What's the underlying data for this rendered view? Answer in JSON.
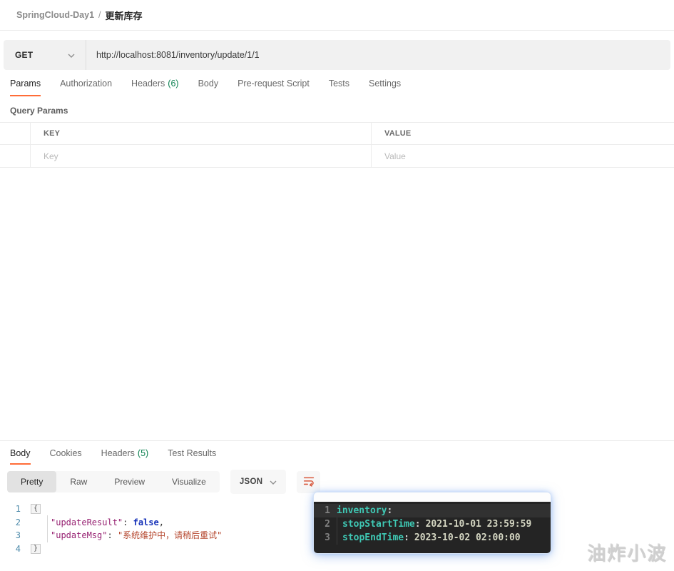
{
  "colors": {
    "accent": "#ff6c37",
    "count_green": "#0b8050",
    "method_bar_bg": "#f1f1f1"
  },
  "breadcrumb": {
    "collection": "SpringCloud-Day1",
    "separator": "/",
    "request_name": "更新库存"
  },
  "request_bar": {
    "method": "GET",
    "url": "http://localhost:8081/inventory/update/1/1"
  },
  "request_tabs": [
    {
      "label": "Params"
    },
    {
      "label": "Authorization"
    },
    {
      "label": "Headers",
      "count": "(6)"
    },
    {
      "label": "Body"
    },
    {
      "label": "Pre-request Script"
    },
    {
      "label": "Tests"
    },
    {
      "label": "Settings"
    }
  ],
  "params_section": {
    "title": "Query Params",
    "columns": [
      "KEY",
      "VALUE"
    ],
    "placeholder_row": {
      "key": "Key",
      "value": "Value"
    }
  },
  "response_tabs": [
    {
      "label": "Body"
    },
    {
      "label": "Cookies"
    },
    {
      "label": "Headers",
      "count": "(5)"
    },
    {
      "label": "Test Results"
    }
  ],
  "response_controls": {
    "views": [
      "Pretty",
      "Raw",
      "Preview",
      "Visualize"
    ],
    "active_view": "Pretty",
    "format": "JSON",
    "wrap_icon": "wrap-text-icon"
  },
  "response_body": {
    "line_numbers": [
      "1",
      "2",
      "3",
      "4"
    ],
    "open_brace": "{",
    "close_brace": "}",
    "entries": [
      {
        "key": "\"updateResult\"",
        "colon": ": ",
        "value": "false",
        "value_type": "boolean",
        "comma": ","
      },
      {
        "key": "\"updateMsg\"",
        "colon": ": ",
        "value": "\"系统维护中，请稍后重试\"",
        "value_type": "string"
      }
    ]
  },
  "overlay_snippet": {
    "lines": [
      {
        "num": "1",
        "key": "inventory",
        "colon": ":",
        "value": ""
      },
      {
        "num": "2",
        "key": "stopStartTime",
        "colon": ":",
        "value": "2021-10-01 23:59:59"
      },
      {
        "num": "3",
        "key": "stopEndTime",
        "colon": ":",
        "value": "2023-10-02 02:00:00"
      }
    ]
  },
  "watermark": "油炸小波"
}
